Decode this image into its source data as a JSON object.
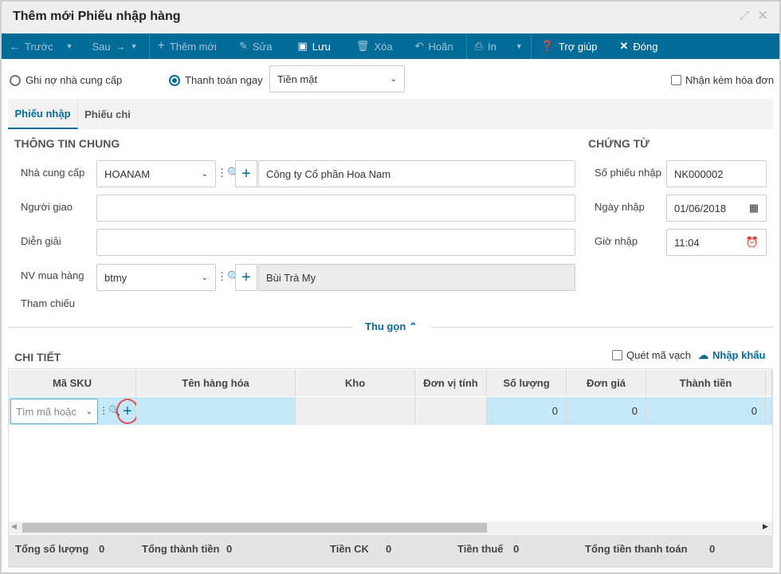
{
  "window": {
    "title": "Thêm mới Phiếu nhập hàng"
  },
  "toolbar": {
    "prev": "Trước",
    "next": "Sau",
    "add": "Thêm mới",
    "edit": "Sửa",
    "save": "Lưu",
    "delete": "Xóa",
    "undo": "Hoãn",
    "print": "In",
    "help": "Trợ giúp",
    "close": "Đóng"
  },
  "payment": {
    "debt": "Ghi nợ nhà cung cấp",
    "pay_now": "Thanh toán ngay",
    "method": "Tiền mặt",
    "invoice": "Nhận kèm hóa đơn"
  },
  "tabs": [
    "Phiếu nhập",
    "Phiếu chi"
  ],
  "general": {
    "heading": "THÔNG TIN CHUNG",
    "supplier_label": "Nhà cung cấp",
    "supplier_code": "HOANAM",
    "supplier_name": "Công ty Cổ phần Hoa Nam",
    "deliverer_label": "Người giao",
    "deliverer": "",
    "desc_label": "Diễn giải",
    "desc": "",
    "buyer_label": "NV mua hàng",
    "buyer_code": "btmy",
    "buyer_name": "Bùi Trà My",
    "ref_label": "Tham chiếu"
  },
  "voucher": {
    "heading": "CHỨNG TỪ",
    "no_label": "Số phiếu nhập",
    "no": "NK000002",
    "date_label": "Ngày nhập",
    "date": "01/06/2018",
    "time_label": "Giờ nhập",
    "time": "11:04"
  },
  "collapse": "Thu gọn",
  "detail": {
    "heading": "CHI TIẾT",
    "scan": "Quét mã vạch",
    "import": "Nhập khẩu",
    "columns": [
      "Mã SKU",
      "Tên hàng hóa",
      "Kho",
      "Đơn vị tính",
      "Số lượng",
      "Đơn giá",
      "Thành tiền"
    ],
    "row": {
      "sku_placeholder": "Tìm mã hoặc",
      "qty": "0",
      "price": "0",
      "amount": "0"
    }
  },
  "totals": [
    {
      "label": "Tổng số lượng",
      "value": "0"
    },
    {
      "label": "Tổng thành tiền",
      "value": "0"
    },
    {
      "label": "Tiền CK",
      "value": "0"
    },
    {
      "label": "Tiền thuế",
      "value": "0"
    },
    {
      "label": "Tổng tiền thanh toán",
      "value": "0"
    }
  ]
}
